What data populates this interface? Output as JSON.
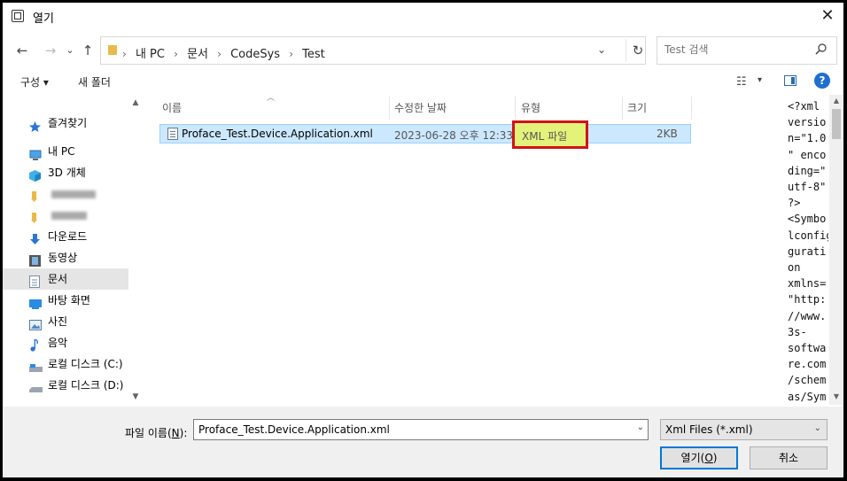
{
  "window": {
    "title": "열기",
    "close_glyph": "✕"
  },
  "nav": {
    "back": "←",
    "forward": "→",
    "up": "↑",
    "refresh": "↻",
    "dropdown": "⌄"
  },
  "breadcrumb": [
    "내 PC",
    "문서",
    "CodeSys",
    "Test"
  ],
  "breadcrumb_sep": "›",
  "search": {
    "placeholder": "Test 검색"
  },
  "toolbar": {
    "organize": "구성 ▾",
    "new_folder": "새 폴더",
    "view_glyph": "☷",
    "view_dd": "▾",
    "help": "?"
  },
  "sidebar": {
    "items": [
      {
        "label": "즐겨찾기",
        "icon": "star-icon"
      },
      {
        "label": "내 PC",
        "icon": "computer-icon"
      },
      {
        "label": "3D 개체",
        "icon": "cube-icon"
      },
      {
        "label": "",
        "icon": "folder-icon"
      },
      {
        "label": "",
        "icon": "folder-icon"
      },
      {
        "label": "다운로드",
        "icon": "download-icon"
      },
      {
        "label": "동영상",
        "icon": "video-icon"
      },
      {
        "label": "문서",
        "icon": "document-icon",
        "selected": true
      },
      {
        "label": "바탕 화면",
        "icon": "desktop-icon"
      },
      {
        "label": "사진",
        "icon": "picture-icon"
      },
      {
        "label": "음악",
        "icon": "music-icon"
      },
      {
        "label": "로컬 디스크 (C:)",
        "icon": "drive-icon"
      },
      {
        "label": "로컬 디스크 (D:)",
        "icon": "drive-icon"
      }
    ]
  },
  "columns": {
    "name": "이름",
    "date": "수정한 날짜",
    "type": "유형",
    "size": "크기"
  },
  "files": [
    {
      "name": "Proface_Test.Device.Application.xml",
      "date": "2023-06-28 오후 12:33",
      "type": "XML 파일",
      "size": "2KB"
    }
  ],
  "preview_lines": [
    "<?xml",
    "versio",
    "n=\"1.0",
    "\" enco",
    "ding=\"",
    "utf-8\"",
    "?>",
    "<Symbo",
    "lconfig",
    "gurati",
    "on",
    "xmlns=",
    "\"http:",
    "//www.",
    "3s-",
    "softwa",
    "re.com",
    "/schem",
    "as/Sym"
  ],
  "filename": {
    "label": "파일 이름(",
    "mnemonic": "N",
    "label_end": "):",
    "value": "Proface_Test.Device.Application.xml"
  },
  "filetype": {
    "value": "Xml Files (*.xml)"
  },
  "buttons": {
    "open": "열기(",
    "open_mnemonic": "O",
    "open_end": ")",
    "cancel": "취소"
  },
  "colors": {
    "selection": "#cce8ff",
    "highlight_border": "#d0121b",
    "highlight_fill": "#e4f27a",
    "accent": "#0078d7"
  }
}
